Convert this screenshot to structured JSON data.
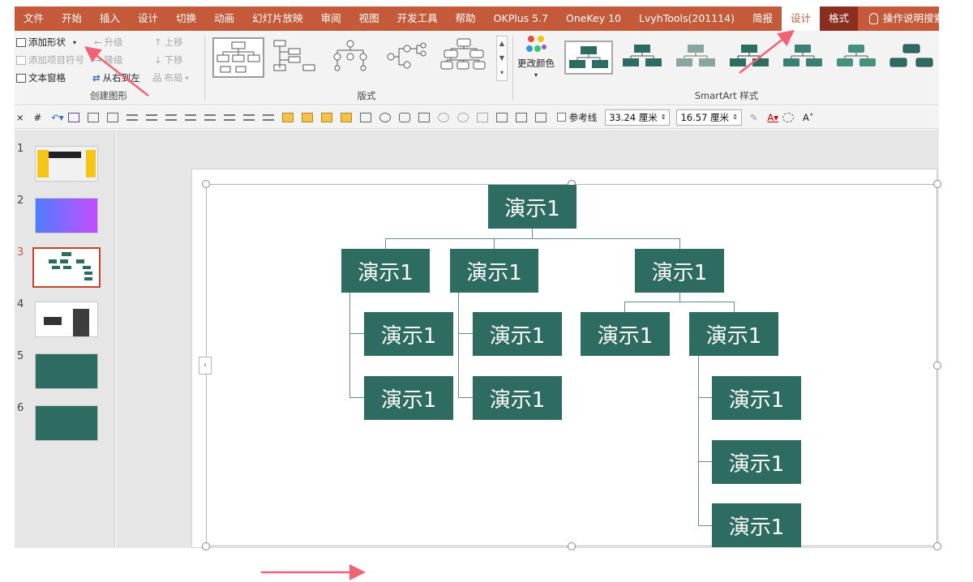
{
  "tabs": [
    {
      "label": "文件"
    },
    {
      "label": "开始"
    },
    {
      "label": "插入"
    },
    {
      "label": "设计"
    },
    {
      "label": "切换"
    },
    {
      "label": "动画"
    },
    {
      "label": "幻灯片放映"
    },
    {
      "label": "审阅"
    },
    {
      "label": "视图"
    },
    {
      "label": "开发工具"
    },
    {
      "label": "帮助"
    },
    {
      "label": "OKPlus 5.7"
    },
    {
      "label": "OneKey 10"
    },
    {
      "label": "LvyhTools(201114)"
    },
    {
      "label": "简报"
    },
    {
      "label": "设计"
    },
    {
      "label": "格式"
    }
  ],
  "help_search": "操作说明搜索",
  "create_group": {
    "label": "创建图形",
    "add_shape": "添加形状",
    "promote": "升级",
    "move_up": "上移",
    "add_bullet": "添加项目符号",
    "demote": "降级",
    "move_down": "下移",
    "text_pane": "文本窗格",
    "right_to_left": "从右到左",
    "layout": "布局"
  },
  "layouts_group": {
    "label": "版式"
  },
  "styles_group": {
    "label": "SmartArt 样式",
    "change_colors": "更改颜色"
  },
  "drawing": {
    "guides_label": "参考线",
    "width_value": "33.24 厘米",
    "height_value": "16.57 厘米"
  },
  "slides": [
    {
      "num": "1"
    },
    {
      "num": "2"
    },
    {
      "num": "3"
    },
    {
      "num": "4"
    },
    {
      "num": "5"
    },
    {
      "num": "6"
    }
  ],
  "orgchart": {
    "top": "演示1",
    "b1": "演示1",
    "b1c1": "演示1",
    "b1c2": "演示1",
    "b2": "演示1",
    "b2c1": "演示1",
    "b2c2": "演示1",
    "b3": "演示1",
    "b3c1": "演示1",
    "b3c2": "演示1",
    "b3c2c1": "演示1",
    "b3c2c2": "演示1",
    "b3c2c3": "演示1"
  },
  "colors": {
    "ribbon_accent": "#c55a3a",
    "node_fill": "#2e6c62",
    "annotation_arrow": "#f06377"
  }
}
